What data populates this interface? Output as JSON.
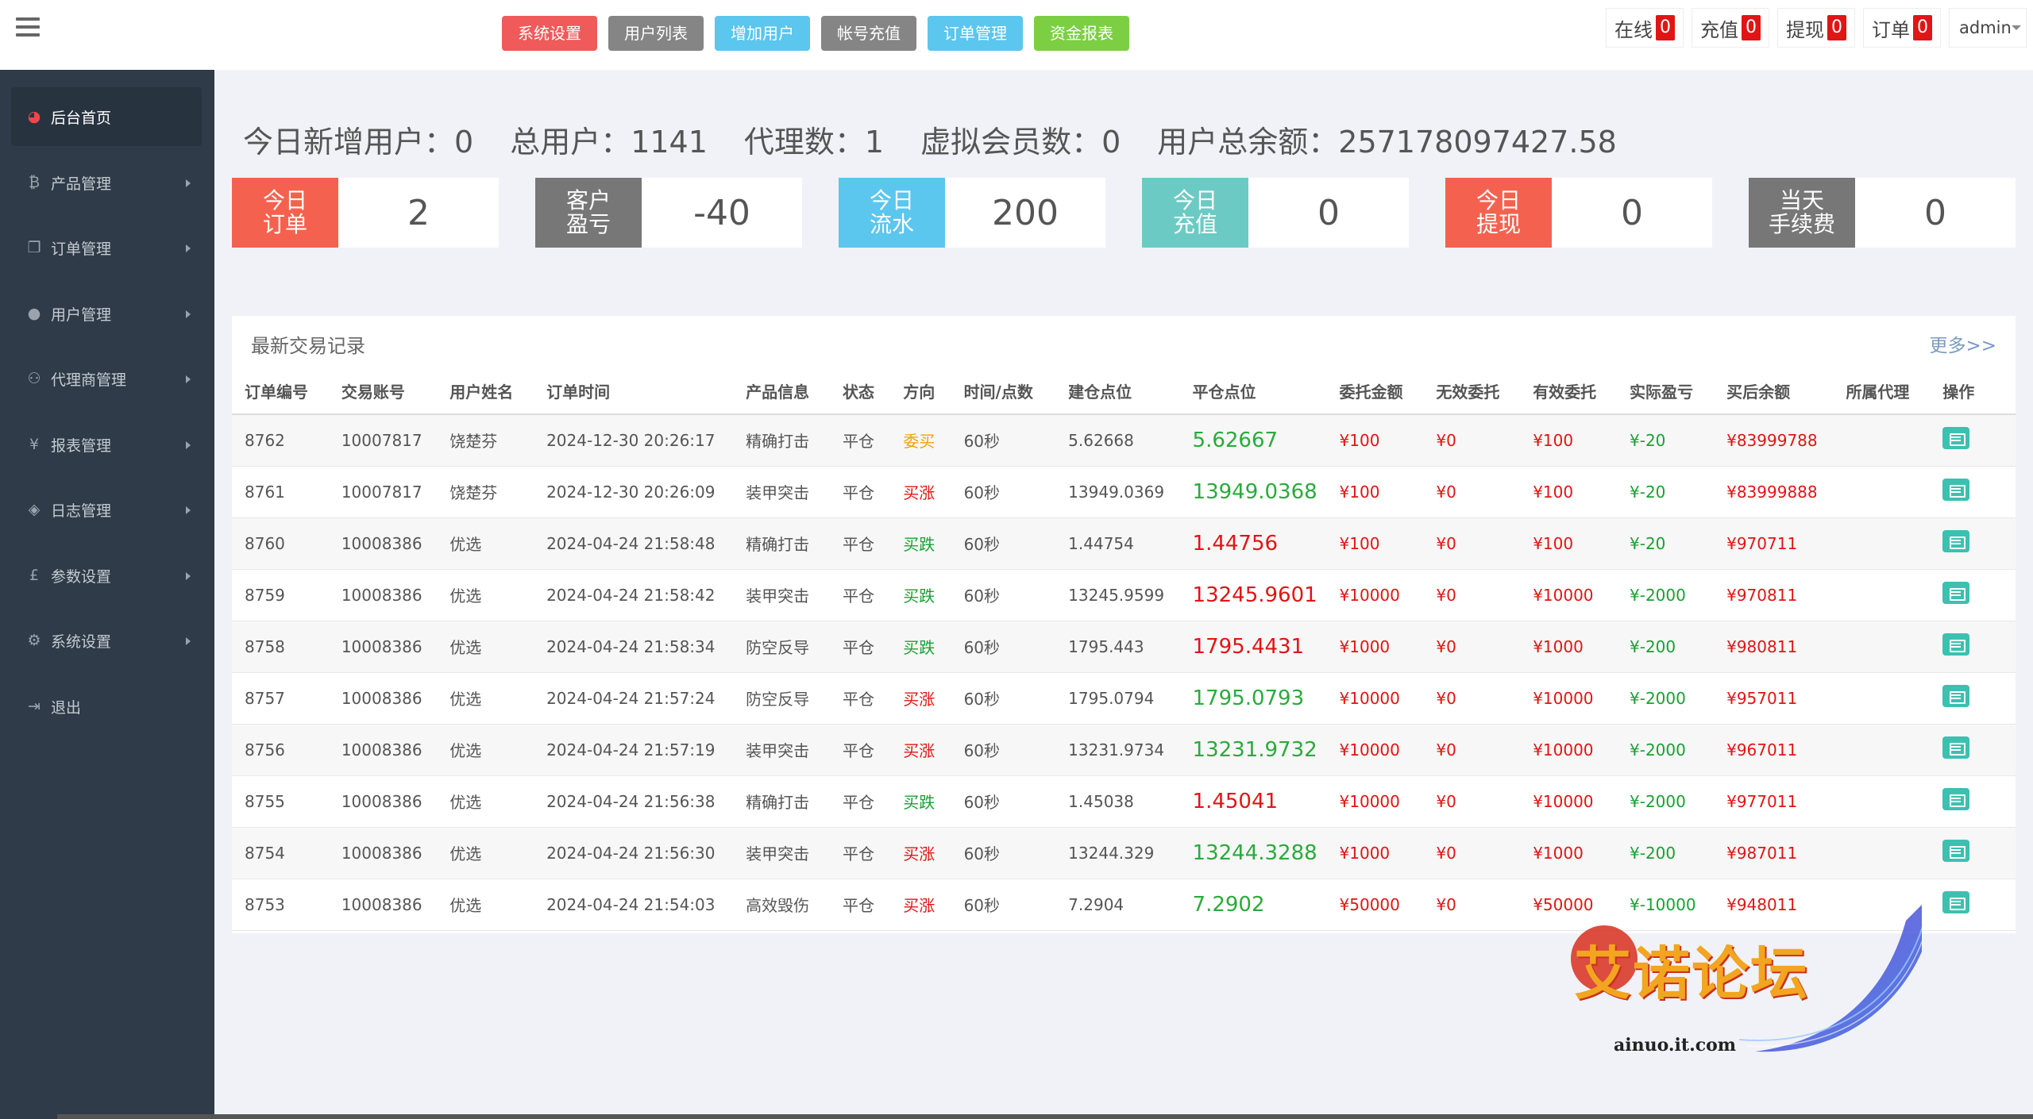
{
  "topnav": [
    {
      "label": "系统设置",
      "color": "#f05a5a"
    },
    {
      "label": "用户列表",
      "color": "#858585"
    },
    {
      "label": "增加用户",
      "color": "#5bc6ee"
    },
    {
      "label": "帐号充值",
      "color": "#858585"
    },
    {
      "label": "订单管理",
      "color": "#5bc6ee"
    },
    {
      "label": "资金报表",
      "color": "#7ccf43"
    }
  ],
  "topright": {
    "online": {
      "label": "在线",
      "count": "0"
    },
    "recharge": {
      "label": "充值",
      "count": "0"
    },
    "withdraw": {
      "label": "提现",
      "count": "0"
    },
    "orders": {
      "label": "订单",
      "count": "0"
    },
    "admin": "admin"
  },
  "sidebar": [
    {
      "label": "后台首页",
      "icon": "dashboard-icon"
    },
    {
      "label": "产品管理",
      "icon": "bitcoin-icon"
    },
    {
      "label": "订单管理",
      "icon": "copy-icon"
    },
    {
      "label": "用户管理",
      "icon": "user-icon"
    },
    {
      "label": "代理商管理",
      "icon": "users-icon"
    },
    {
      "label": "报表管理",
      "icon": "yen-icon"
    },
    {
      "label": "日志管理",
      "icon": "tag-icon"
    },
    {
      "label": "参数设置",
      "icon": "pound-icon"
    },
    {
      "label": "系统设置",
      "icon": "gears-icon"
    },
    {
      "label": "退出",
      "icon": "sign-out-icon"
    }
  ],
  "summary": {
    "new_users": "今日新增用户：0",
    "total_users": "总用户：1141",
    "agents": "代理数：1",
    "virtual_members": "虚拟会员数：0",
    "total_balance": "用户总余额：257178097427.58"
  },
  "cards": [
    {
      "label1": "今日",
      "label2": "订单",
      "value": "2",
      "color": "#f4624f"
    },
    {
      "label1": "客户",
      "label2": "盈亏",
      "value": "-40",
      "color": "#777777"
    },
    {
      "label1": "今日",
      "label2": "流水",
      "value": "200",
      "color": "#5bc6ee"
    },
    {
      "label1": "今日",
      "label2": "充值",
      "value": "0",
      "color": "#6ccac4"
    },
    {
      "label1": "今日",
      "label2": "提现",
      "value": "0",
      "color": "#f4624f"
    },
    {
      "label1": "当天",
      "label2": "手续费",
      "value": "0",
      "color": "#777777"
    }
  ],
  "trades": {
    "title": "最新交易记录",
    "more": "更多>>",
    "headers": [
      "订单编号",
      "交易账号",
      "用户姓名",
      "订单时间",
      "产品信息",
      "状态",
      "方向",
      "时间/点数",
      "建仓点位",
      "平仓点位",
      "委托金额",
      "无效委托",
      "有效委托",
      "实际盈亏",
      "买后余额",
      "所属代理",
      "操作"
    ],
    "rows": [
      {
        "id": "8762",
        "account": "10007817",
        "name": "饶楚芬",
        "time": "2024-12-30 20:26:17",
        "product": "精确打击",
        "status": "平仓",
        "direction": "委买",
        "dir_color": "orange",
        "period": "60秒",
        "open": "5.62668",
        "close": "5.62667",
        "close_color": "pos-green",
        "amount": "¥100",
        "invalid": "¥0",
        "valid": "¥100",
        "pnl": "¥-20",
        "balance": "¥83999788",
        "agent": ""
      },
      {
        "id": "8761",
        "account": "10007817",
        "name": "饶楚芬",
        "time": "2024-12-30 20:26:09",
        "product": "装甲突击",
        "status": "平仓",
        "direction": "买涨",
        "dir_color": "red",
        "period": "60秒",
        "open": "13949.0369",
        "close": "13949.0368",
        "close_color": "pos-green",
        "amount": "¥100",
        "invalid": "¥0",
        "valid": "¥100",
        "pnl": "¥-20",
        "balance": "¥83999888",
        "agent": ""
      },
      {
        "id": "8760",
        "account": "10008386",
        "name": "优选",
        "time": "2024-04-24 21:58:48",
        "product": "精确打击",
        "status": "平仓",
        "direction": "买跌",
        "dir_color": "green",
        "period": "60秒",
        "open": "1.44754",
        "close": "1.44756",
        "close_color": "red",
        "amount": "¥100",
        "invalid": "¥0",
        "valid": "¥100",
        "pnl": "¥-20",
        "balance": "¥970711",
        "agent": ""
      },
      {
        "id": "8759",
        "account": "10008386",
        "name": "优选",
        "time": "2024-04-24 21:58:42",
        "product": "装甲突击",
        "status": "平仓",
        "direction": "买跌",
        "dir_color": "green",
        "period": "60秒",
        "open": "13245.9599",
        "close": "13245.9601",
        "close_color": "red",
        "amount": "¥10000",
        "invalid": "¥0",
        "valid": "¥10000",
        "pnl": "¥-2000",
        "balance": "¥970811",
        "agent": ""
      },
      {
        "id": "8758",
        "account": "10008386",
        "name": "优选",
        "time": "2024-04-24 21:58:34",
        "product": "防空反导",
        "status": "平仓",
        "direction": "买跌",
        "dir_color": "green",
        "period": "60秒",
        "open": "1795.443",
        "close": "1795.4431",
        "close_color": "red",
        "amount": "¥1000",
        "invalid": "¥0",
        "valid": "¥1000",
        "pnl": "¥-200",
        "balance": "¥980811",
        "agent": ""
      },
      {
        "id": "8757",
        "account": "10008386",
        "name": "优选",
        "time": "2024-04-24 21:57:24",
        "product": "防空反导",
        "status": "平仓",
        "direction": "买涨",
        "dir_color": "red",
        "period": "60秒",
        "open": "1795.0794",
        "close": "1795.0793",
        "close_color": "pos-green",
        "amount": "¥10000",
        "invalid": "¥0",
        "valid": "¥10000",
        "pnl": "¥-2000",
        "balance": "¥957011",
        "agent": ""
      },
      {
        "id": "8756",
        "account": "10008386",
        "name": "优选",
        "time": "2024-04-24 21:57:19",
        "product": "装甲突击",
        "status": "平仓",
        "direction": "买涨",
        "dir_color": "red",
        "period": "60秒",
        "open": "13231.9734",
        "close": "13231.9732",
        "close_color": "pos-green",
        "amount": "¥10000",
        "invalid": "¥0",
        "valid": "¥10000",
        "pnl": "¥-2000",
        "balance": "¥967011",
        "agent": ""
      },
      {
        "id": "8755",
        "account": "10008386",
        "name": "优选",
        "time": "2024-04-24 21:56:38",
        "product": "精确打击",
        "status": "平仓",
        "direction": "买跌",
        "dir_color": "green",
        "period": "60秒",
        "open": "1.45038",
        "close": "1.45041",
        "close_color": "red",
        "amount": "¥10000",
        "invalid": "¥0",
        "valid": "¥10000",
        "pnl": "¥-2000",
        "balance": "¥977011",
        "agent": ""
      },
      {
        "id": "8754",
        "account": "10008386",
        "name": "优选",
        "time": "2024-04-24 21:56:30",
        "product": "装甲突击",
        "status": "平仓",
        "direction": "买涨",
        "dir_color": "red",
        "period": "60秒",
        "open": "13244.329",
        "close": "13244.3288",
        "close_color": "pos-green",
        "amount": "¥1000",
        "invalid": "¥0",
        "valid": "¥1000",
        "pnl": "¥-200",
        "balance": "¥987011",
        "agent": ""
      },
      {
        "id": "8753",
        "account": "10008386",
        "name": "优选",
        "time": "2024-04-24 21:54:03",
        "product": "高效毁伤",
        "status": "平仓",
        "direction": "买涨",
        "dir_color": "red",
        "period": "60秒",
        "open": "7.2904",
        "close": "7.2902",
        "close_color": "pos-green",
        "amount": "¥50000",
        "invalid": "¥0",
        "valid": "¥50000",
        "pnl": "¥-10000",
        "balance": "¥948011",
        "agent": ""
      }
    ]
  },
  "watermark": {
    "title": "艾诺论坛",
    "site": "ainuo.it.com"
  }
}
